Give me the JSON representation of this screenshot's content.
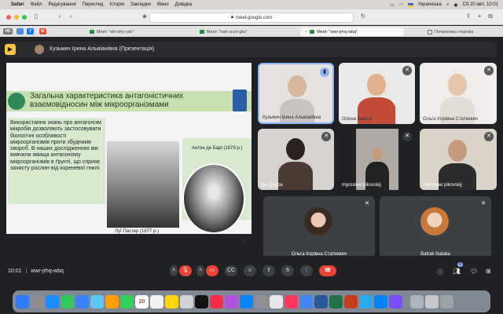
{
  "menubar": {
    "items": [
      "Safari",
      "Файл",
      "Редагування",
      "Перегляд",
      "Історія",
      "Закладки",
      "Вікно",
      "Довідка"
    ],
    "keyboard_layout": "Українська",
    "datetime": "Сб 20 квіт.  10:01"
  },
  "browser": {
    "url": "meet.google.com",
    "tabs": [
      {
        "label": "Meet: \"xih-ofry-ydv\"",
        "active": false
      },
      {
        "label": "Meet: \"hah-vczn-gkz\"",
        "active": false
      },
      {
        "label": "Meet: \"wwr-jrhq-wbq\"",
        "active": true
      },
      {
        "label": "Початкова сторінка",
        "active": false
      }
    ]
  },
  "meet": {
    "presenter_label": "Кузьмич Ірина Альвіанівна (Презентація)",
    "slide": {
      "title": "Загальна характеристика антагоністичних взаємовідносин між мікроорганізмами",
      "body": "Використання знань про антагонізм мікробів дозволяють застосовувати біологічні особливості мікроорганізмів проти збудників хвороб. В наших дослідженнях ми вивчили явища антагонізму мікроорганізмів в ґрунті, що сприяє захисту рослин від кореневої гнилі.",
      "caption_left": "Луї Пастер (1877 р.)",
      "caption_right": "Антон де Барі (1879 р.)",
      "page_number": "3"
    },
    "tiles": [
      {
        "name": "Кузьмич Ірина Альвіанівна"
      },
      {
        "name": "Олена Башта"
      },
      {
        "name": "Ольга Ігорівна Статкевич"
      },
      {
        "name": "Іра Джура"
      },
      {
        "name": "myroslaw pikovskij"
      },
      {
        "name": "myroslaw pikovskij"
      },
      {
        "name": "Ольга Ігорівна Статкевич"
      },
      {
        "name": "Batrak Natalia"
      }
    ],
    "meeting_time": "10:01",
    "meeting_code": "wwr-jrhq-wbq",
    "participants_count": "9"
  }
}
